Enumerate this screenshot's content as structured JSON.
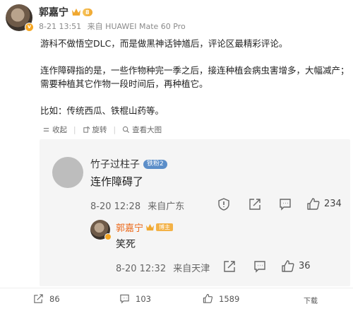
{
  "post": {
    "author": "郭嘉宁",
    "level_badge": "8",
    "date": "8-21 13:51",
    "source": "来自 HUAWEI Mate 60 Pro",
    "paragraphs": [
      "游科不做悟空DLC，而是做黑神话钟馗后，评论区最精彩评论。",
      "连作障碍指的是，一些作物种完一季之后，接连种植会病虫害增多，大幅减产；",
      "需要种植其它作物一段时间后，再种植它。",
      "比如：传统西瓜、铁棍山药等。"
    ],
    "tools": {
      "collapse": "收起",
      "rotate": "旋转",
      "view_large": "查看大图"
    }
  },
  "comment": {
    "author": "竹子过柱子",
    "fan_badge": "铁粉2",
    "text": "连作障碍了",
    "date": "8-20 12:28",
    "location": "来自广东",
    "likes": "234",
    "reply": {
      "author": "郭嘉宁",
      "badge": "博主",
      "text": "笑死",
      "date": "8-20 12:32",
      "location": "来自天津",
      "likes": "36"
    }
  },
  "bottom_bar": {
    "reposts": "86",
    "comments": "103",
    "likes": "1589",
    "download": "下载"
  },
  "colors": {
    "reply_author": "#ec6a1c",
    "card_bg": "#f5f5f5",
    "level_gold": "#f0a830",
    "fan_blue": "#5b8ec9"
  }
}
